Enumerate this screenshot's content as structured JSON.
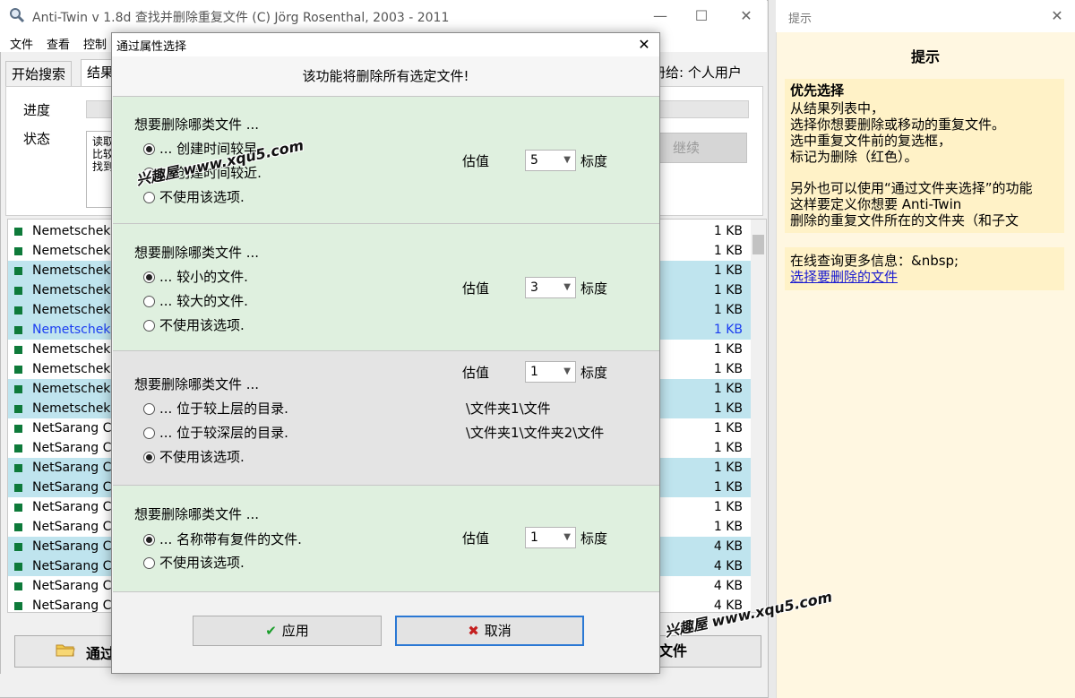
{
  "main_window": {
    "title": "Anti-Twin    v 1.8d     查找并删除重复文件    (C) Jörg Rosenthal, 2003 - 2011",
    "controls": {
      "minimize": "—",
      "maximize": "☐",
      "close": "✕"
    },
    "menu": [
      "文件",
      "查看",
      "控制"
    ],
    "tabs": [
      "开始搜索",
      "结果"
    ],
    "register_text": "册给: 个人用户",
    "progress_label": "进度",
    "status_label": "状态",
    "status_text": "读取\n比较\n找到",
    "continue_button": "继续",
    "bottom_left_button": "通过",
    "bottom_right_button": "文件"
  },
  "file_list": [
    {
      "name": "Nemetschek",
      "size": "1 KB",
      "selected": false
    },
    {
      "name": "Nemetschek",
      "size": "1 KB",
      "selected": false
    },
    {
      "name": "Nemetschek",
      "size": "1 KB",
      "selected": true
    },
    {
      "name": "Nemetschek",
      "size": "1 KB",
      "selected": true
    },
    {
      "name": "Nemetschek",
      "size": "1 KB",
      "selected": true
    },
    {
      "name": "Nemetschek",
      "size": "1 KB",
      "selected": true,
      "highlight": true
    },
    {
      "name": "Nemetschek",
      "size": "1 KB",
      "selected": false
    },
    {
      "name": "Nemetschek",
      "size": "1 KB",
      "selected": false
    },
    {
      "name": "Nemetschek",
      "size": "1 KB",
      "selected": true
    },
    {
      "name": "Nemetschek",
      "size": "1 KB",
      "selected": true
    },
    {
      "name": "NetSarang C",
      "size": "1 KB",
      "selected": false
    },
    {
      "name": "NetSarang C",
      "size": "1 KB",
      "selected": false
    },
    {
      "name": "NetSarang C",
      "size": "1 KB",
      "selected": true
    },
    {
      "name": "NetSarang C",
      "size": "1 KB",
      "selected": true
    },
    {
      "name": "NetSarang C",
      "size": "1 KB",
      "selected": false
    },
    {
      "name": "NetSarang C",
      "size": "1 KB",
      "selected": false
    },
    {
      "name": "NetSarang C",
      "size": "4 KB",
      "selected": true
    },
    {
      "name": "NetSarang C",
      "size": "4 KB",
      "selected": true
    },
    {
      "name": "NetSarang C",
      "size": "4 KB",
      "selected": false
    },
    {
      "name": "NetSarang C",
      "size": "4 KB",
      "selected": false
    }
  ],
  "tips": {
    "window_title": "提示",
    "heading": "提示",
    "subheading": "优先选择",
    "lines": [
      "从结果列表中，",
      "选择你想要删除或移动的重复文件。",
      "选中重复文件前的复选框，",
      "标记为删除（红色）。",
      "",
      "另外也可以使用“通过文件夹选择”的功能",
      "这样要定义你想要 Anti-Twin",
      "删除的重复文件所在的文件夹（和子文"
    ],
    "more_info": "在线查询更多信息：&nbsp;",
    "link": "选择要删除的文件"
  },
  "dialog": {
    "title": "通过属性选择",
    "close": "✕",
    "header": "该功能将删除所有选定文件!",
    "sections": [
      {
        "question": "想要删除哪类文件 ...",
        "options": [
          "... 创建时间较早.",
          "... 创建时间较近.",
          "不使用该选项."
        ],
        "selected": 0,
        "weight_label": "估值",
        "weight": "5",
        "scale_label": "标度"
      },
      {
        "question": "想要删除哪类文件 ...",
        "options": [
          "... 较小的文件.",
          "... 较大的文件.",
          "不使用该选项."
        ],
        "selected": 0,
        "weight_label": "估值",
        "weight": "3",
        "scale_label": "标度"
      },
      {
        "question": "想要删除哪类文件 ...",
        "options": [
          "... 位于较上层的目录.",
          "... 位于较深层的目录.",
          "不使用该选项."
        ],
        "selected": 2,
        "weight_label": "估值",
        "weight": "1",
        "scale_label": "标度",
        "paths": [
          "\\文件夹1\\文件",
          "\\文件夹1\\文件夹2\\文件"
        ]
      },
      {
        "question": "想要删除哪类文件 ...",
        "options": [
          "... 名称带有复件的文件.",
          "不使用该选项."
        ],
        "selected": 0,
        "weight_label": "估值",
        "weight": "1",
        "scale_label": "标度"
      }
    ],
    "apply_button": "应用",
    "cancel_button": "取消"
  },
  "watermarks": [
    "兴趣屋 www.xqu5.com",
    "兴趣屋 www.xqu5.com"
  ]
}
